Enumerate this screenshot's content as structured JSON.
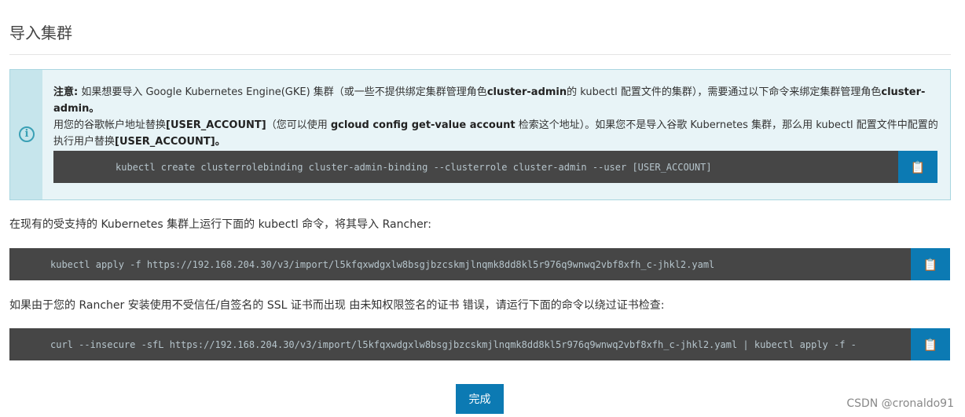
{
  "page": {
    "title": "导入集群"
  },
  "note": {
    "label": "注意:",
    "t1": " 如果想要导入 Google Kubernetes Engine(GKE) 集群（或一些不提供绑定集群管理角色",
    "b1": "cluster-admin",
    "t2": "的 kubectl 配置文件的集群），需要通过以下命令来绑定集群管理角色",
    "b2": "cluster-admin。",
    "t3": "用您的谷歌帐户地址替换",
    "b3": "[USER_ACCOUNT]",
    "t4": "（您可以使用 ",
    "b4": "gcloud config get-value account",
    "t5": " 检索这个地址）。如果您不是导入谷歌 Kubernetes 集群，那么用 kubectl 配置文件中配置的执行用户替换",
    "b5": "[USER_ACCOUNT]。",
    "command": "kubectl create clusterrolebinding cluster-admin-binding --clusterrole cluster-admin --user [USER_ACCOUNT]"
  },
  "import": {
    "instruction": "在现有的受支持的 Kubernetes 集群上运行下面的 kubectl 命令，将其导入 Rancher:",
    "command": "kubectl apply -f https://192.168.204.30/v3/import/l5kfqxwdgxlw8bsgjbzcskmjlnqmk8dd8kl5r976q9wnwq2vbf8xfh_c-jhkl2.yaml"
  },
  "insecure": {
    "instruction": "如果由于您的 Rancher 安装使用不受信任/自签名的 SSL 证书而出现 由未知权限签名的证书 错误，请运行下面的命令以绕过证书检查:",
    "command": "curl --insecure -sfL https://192.168.204.30/v3/import/l5kfqxwdgxlw8bsgjbzcskmjlnqmk8dd8kl5r976q9wnwq2vbf8xfh_c-jhkl2.yaml | kubectl apply -f -"
  },
  "icons": {
    "info": "info-circle-icon",
    "copy": "clipboard-copy-icon"
  },
  "copy_glyph": "📋",
  "done_label": "完成",
  "watermark": "CSDN @cronaldo91",
  "colors": {
    "accent": "#0c7ab3",
    "code_bg": "#464646",
    "note_bg": "#e8f4f7",
    "info": "#3aa0b5"
  }
}
